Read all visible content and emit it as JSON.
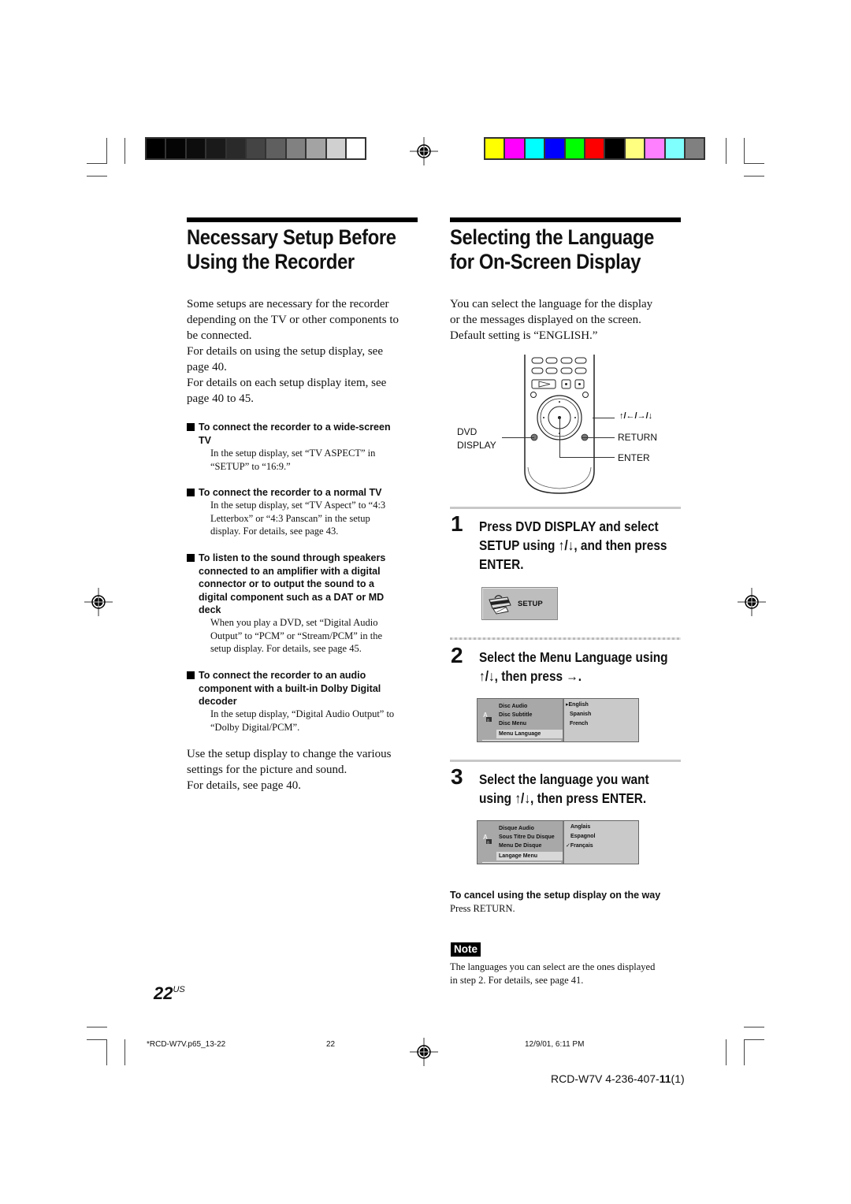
{
  "color_bars": {
    "grayscale": [
      "#000000",
      "#050505",
      "#0d0d0d",
      "#1a1a1a",
      "#2a2a2a",
      "#444444",
      "#5f5f5f",
      "#818181",
      "#a3a3a3",
      "#d0d0d0",
      "#ffffff"
    ],
    "process": [
      "#ffff00",
      "#ff00ff",
      "#00ffff",
      "#0000ff",
      "#00ff00",
      "#ff0000",
      "#000000",
      "#ffff80",
      "#ff80ff",
      "#80ffff",
      "#808080"
    ]
  },
  "left": {
    "title_line1": "Necessary Setup Before",
    "title_line2": "Using the Recorder",
    "intro": [
      "Some setups are necessary for the recorder",
      "depending on the TV or other components to",
      "be connected.",
      "For details on using the setup display, see",
      "page 40.",
      "For details on each setup display item, see",
      "page 40 to 45."
    ],
    "sections": [
      {
        "heading": [
          "To connect the recorder to a wide-screen",
          "TV"
        ],
        "body": [
          "In the setup display, set “TV ASPECT” in",
          "“SETUP” to “16:9.”"
        ]
      },
      {
        "heading": [
          "To connect the recorder to a normal TV"
        ],
        "body": [
          "In the setup display, set “TV Aspect” to “4:3",
          "Letterbox” or “4:3 Panscan” in the setup",
          "display. For details, see page 43."
        ]
      },
      {
        "heading": [
          "To listen to the sound through speakers",
          "connected to an amplifier with a digital",
          "connector or to output the sound to a",
          "digital component such as a DAT or MD",
          "deck"
        ],
        "body": [
          "When you play a DVD, set “Digital Audio",
          "Output” to “PCM” or “Stream/PCM” in the",
          "setup display. For details, see page 45."
        ]
      },
      {
        "heading": [
          "To connect the recorder to an audio",
          "component with a built-in Dolby Digital",
          "decoder"
        ],
        "body": [
          "In the setup display, “Digital Audio Output” to",
          "“Dolby Digital/PCM”."
        ]
      }
    ],
    "closing": [
      "Use the setup display to change the various",
      "settings for the picture and sound.",
      "For details, see page 40."
    ],
    "page_number": "22",
    "page_suffix": "US"
  },
  "right": {
    "title_line1": "Selecting the Language",
    "title_line2": "for On-Screen Display",
    "intro": [
      "You can select the language for the display",
      "or the messages displayed on the screen.",
      "Default setting is “ENGLISH.”"
    ],
    "remote": {
      "label_dvd_display_1": "DVD",
      "label_dvd_display_2": "DISPLAY",
      "label_arrows": "↑/←/→/↓",
      "label_return": "RETURN",
      "label_enter": "ENTER"
    },
    "steps": [
      {
        "number": "1",
        "lines": [
          "Press DVD DISPLAY and select",
          "SETUP using ↑/↓, and then press",
          "ENTER."
        ],
        "setup_button_label": "SETUP"
      },
      {
        "number": "2",
        "lines": [
          "Select the Menu Language using",
          "↑/↓, then press →."
        ],
        "menu_items": [
          "Disc Audio",
          "Disc Subtitle",
          "Disc Menu"
        ],
        "selected_item": "Menu Language",
        "options": [
          "▸English",
          "Spanish",
          "French"
        ]
      },
      {
        "number": "3",
        "lines": [
          "Select the language you want",
          "using ↑/↓, then press ENTER."
        ],
        "menu_items": [
          "Disque Audio",
          "Sous Titre Du Disque",
          "Menu De Disque"
        ],
        "selected_item": "Langage Menu",
        "options": [
          "Anglais",
          "Espagnol",
          "✓Français"
        ]
      }
    ],
    "cancel_heading": "To cancel using the setup display on the way",
    "cancel_body": "Press RETURN.",
    "note_label": "Note",
    "note_text": [
      "The languages you can select are the ones displayed",
      "in step 2. For details, see page 41."
    ]
  },
  "footer": {
    "file_name": "*RCD-W7V.p65_13-22",
    "page": "22",
    "timestamp": "12/9/01, 6:11 PM",
    "model_prefix": "RCD-W7V 4-236-407-",
    "model_bold": "11",
    "model_suffix": "(1)"
  }
}
